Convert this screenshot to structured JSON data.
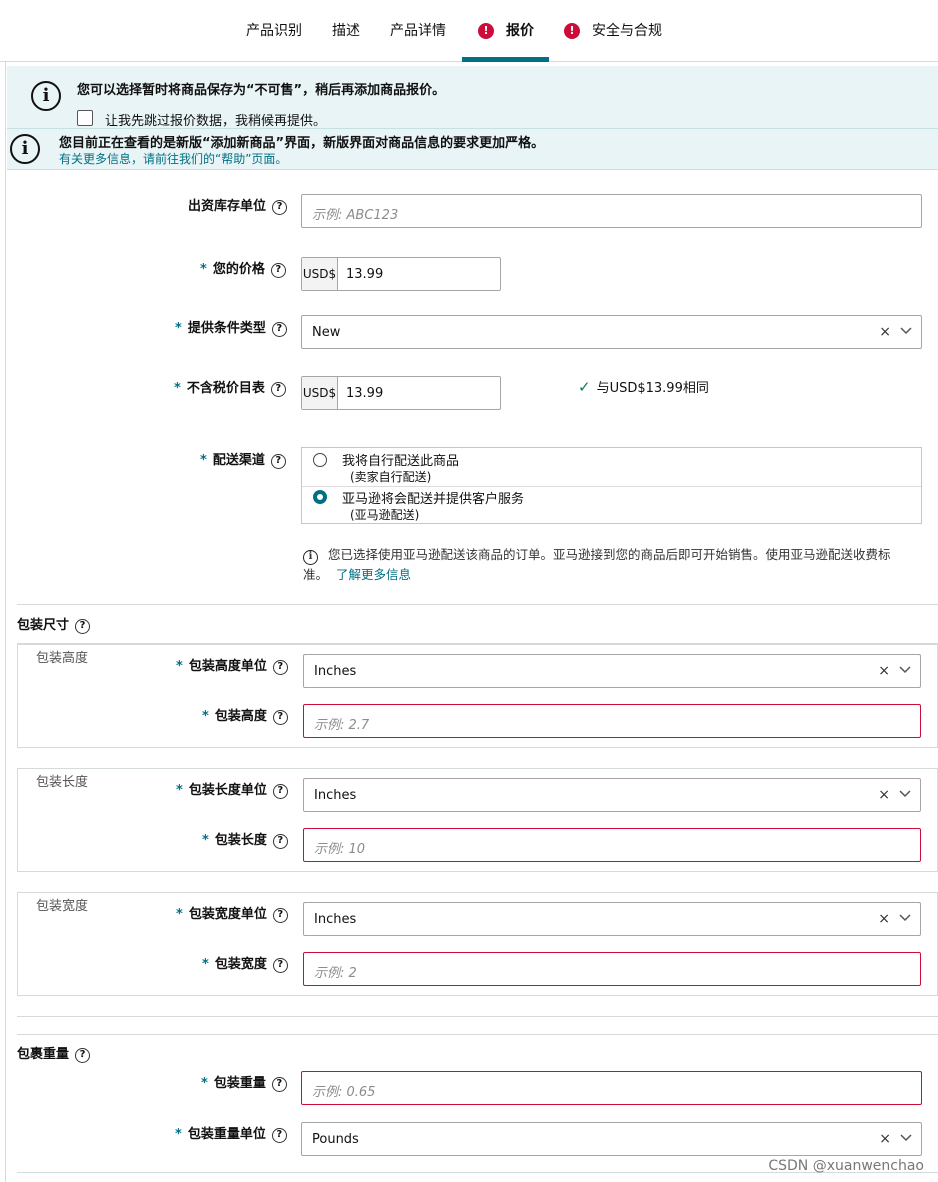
{
  "tabs": [
    {
      "label": "产品识别",
      "error": false,
      "active": false
    },
    {
      "label": "描述",
      "error": false,
      "active": false
    },
    {
      "label": "产品详情",
      "error": false,
      "active": false
    },
    {
      "label": "报价",
      "error": true,
      "active": true
    },
    {
      "label": "安全与合规",
      "error": true,
      "active": false
    }
  ],
  "notice1": {
    "text": "您可以选择暂时将商品保存为“不可售”，稍后再添加商品报价。",
    "checkbox_label": "让我先跳过报价数据，我稍候再提供。",
    "checked": false
  },
  "notice2": {
    "text": "您目前正在查看的是新版“添加新商品”界面，新版界面对商品信息的要求更加严格。",
    "link_text": "有关更多信息，请前往我们的“帮助”页面。"
  },
  "form": {
    "sku": {
      "label": "出资库存单位",
      "placeholder": "示例:  ABC123"
    },
    "price": {
      "label": "您的价格",
      "currency": "USD$",
      "value": "13.99"
    },
    "condition": {
      "label": "提供条件类型",
      "value": "New"
    },
    "list_price": {
      "label": "不含税价目表",
      "currency": "USD$",
      "value": "13.99",
      "validation": "与USD$13.99相同"
    },
    "fulfillment": {
      "label": "配送渠道",
      "options": [
        {
          "title": "我将自行配送此商品",
          "sub": "(卖家自行配送)",
          "selected": false
        },
        {
          "title": "亚马逊将会配送并提供客户服务",
          "sub": "(亚马逊配送)",
          "selected": true
        }
      ],
      "note": "您已选择使用亚马逊配送该商品的订单。亚马逊接到您的商品后即可开始销售。使用亚马逊配送收费标",
      "note_cont": "准。",
      "note_link": "了解更多信息"
    }
  },
  "package_dimensions": {
    "title": "包装尺寸",
    "groups": [
      {
        "legend": "包装高度",
        "unit_label": "包装高度单位",
        "unit_value": "Inches",
        "value_label": "包装高度",
        "placeholder": "示例:  2.7"
      },
      {
        "legend": "包装长度",
        "unit_label": "包装长度单位",
        "unit_value": "Inches",
        "value_label": "包装长度",
        "placeholder": "示例:  10"
      },
      {
        "legend": "包装宽度",
        "unit_label": "包装宽度单位",
        "unit_value": "Inches",
        "value_label": "包装宽度",
        "placeholder": "示例:  2"
      }
    ]
  },
  "package_weight": {
    "title": "包裹重量",
    "weight_label": "包装重量",
    "weight_placeholder": "示例:  0.65",
    "unit_label": "包装重量单位",
    "unit_value": "Pounds"
  },
  "symbols": {
    "clear": "×",
    "help": "?",
    "info": "i",
    "error": "!",
    "required": "*",
    "check": "✓"
  },
  "watermark": "CSDN @xuanwenchao",
  "colors": {
    "accent": "#007185",
    "error": "#cc0c39",
    "notice_bg": "#e8f4f5",
    "success": "#067d62"
  }
}
